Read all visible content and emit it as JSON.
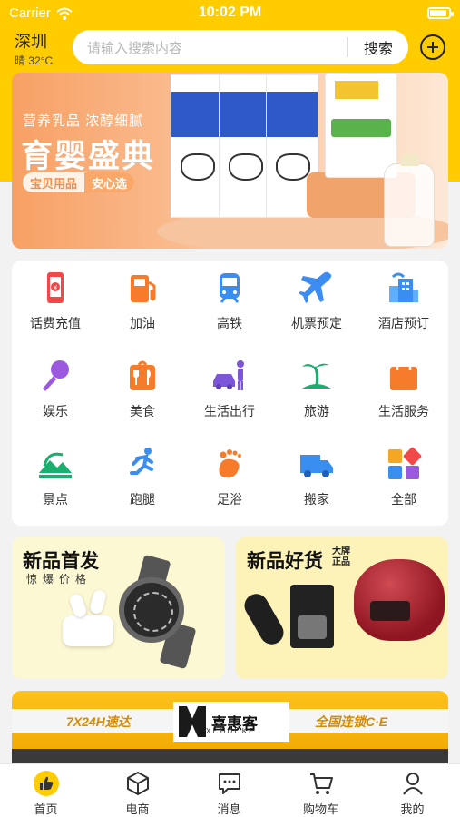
{
  "status": {
    "carrier": "Carrier",
    "time": "10:02 PM"
  },
  "header": {
    "city": "深圳",
    "weather": "晴 32°C",
    "search_placeholder": "请输入搜索内容",
    "search_button": "搜索"
  },
  "banner": {
    "subtitle": "营养乳品 浓醇细腻",
    "title": "育婴盛典",
    "tag_left": "宝贝用品",
    "tag_right": "安心选"
  },
  "services": [
    {
      "label": "话费充值",
      "icon": "phone-recharge-icon"
    },
    {
      "label": "加油",
      "icon": "gas-pump-icon"
    },
    {
      "label": "高铁",
      "icon": "train-icon"
    },
    {
      "label": "机票预定",
      "icon": "airplane-icon"
    },
    {
      "label": "酒店预订",
      "icon": "hotel-icon"
    },
    {
      "label": "娱乐",
      "icon": "microphone-icon"
    },
    {
      "label": "美食",
      "icon": "food-icon"
    },
    {
      "label": "生活出行",
      "icon": "car-person-icon"
    },
    {
      "label": "旅游",
      "icon": "palm-island-icon"
    },
    {
      "label": "生活服务",
      "icon": "shopping-bag-icon"
    },
    {
      "label": "景点",
      "icon": "mountain-icon"
    },
    {
      "label": "跑腿",
      "icon": "runner-icon"
    },
    {
      "label": "足浴",
      "icon": "foot-icon"
    },
    {
      "label": "搬家",
      "icon": "truck-icon"
    },
    {
      "label": "全部",
      "icon": "grid-all-icon"
    }
  ],
  "promo_left": {
    "title": "新品首发",
    "subtitle": "惊爆价格"
  },
  "promo_right": {
    "title": "新品好货",
    "badge_line1": "大牌",
    "badge_line2": "正品"
  },
  "store": {
    "left_text": "7X24H速达",
    "brand": "喜惠客",
    "brand_sub": "XI HUI KE",
    "right_text": "全国连锁C·E"
  },
  "tabs": [
    {
      "label": "首页",
      "icon": "thumbs-up-icon",
      "active": true
    },
    {
      "label": "电商",
      "icon": "box-icon",
      "active": false
    },
    {
      "label": "消息",
      "icon": "message-icon",
      "active": false
    },
    {
      "label": "购物车",
      "icon": "cart-icon",
      "active": false
    },
    {
      "label": "我的",
      "icon": "user-icon",
      "active": false
    }
  ],
  "colors": {
    "accent": "#ffcc00",
    "text": "#333333"
  }
}
